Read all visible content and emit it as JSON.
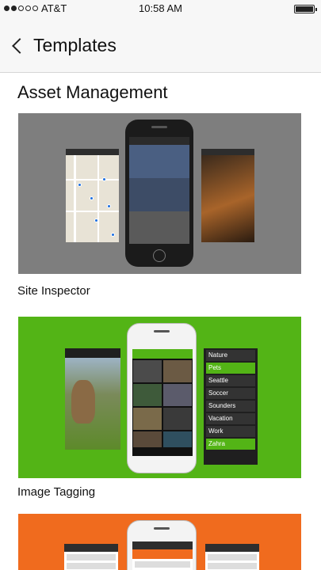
{
  "status_bar": {
    "carrier": "AT&T",
    "time": "10:58 AM",
    "signal_bars_filled": 2,
    "signal_bars_total": 5,
    "battery_level": 1.0
  },
  "nav": {
    "title": "Templates"
  },
  "section": {
    "title": "Asset Management"
  },
  "templates": [
    {
      "label": "Site Inspector",
      "color": "#7e7e7e"
    },
    {
      "label": "Image Tagging",
      "color": "#53b416"
    },
    {
      "label": "",
      "color": "#f06b1e"
    }
  ],
  "image_tagging_tags": [
    "Nature",
    "Pets",
    "Seattle",
    "Soccer",
    "Sounders",
    "Vacation",
    "Work",
    "Zahra"
  ],
  "image_tagging_selected": [
    "Pets",
    "Zahra"
  ],
  "icons": {
    "back": "chevron-left-icon",
    "battery": "battery-icon",
    "signal": "signal-dots-icon"
  }
}
